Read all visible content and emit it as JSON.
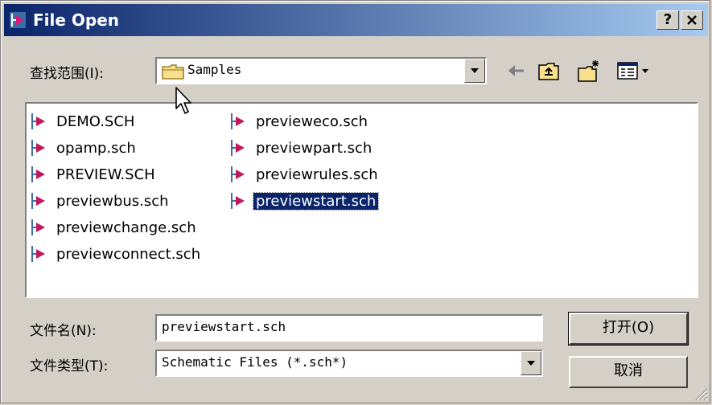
{
  "titlebar": {
    "title": "File Open",
    "help_label": "?",
    "close_label": "X"
  },
  "lookin": {
    "label": "查找范围(I):",
    "value": "Samples"
  },
  "files": {
    "col1": [
      "DEMO.SCH",
      "opamp.sch",
      "PREVIEW.SCH",
      "previewbus.sch",
      "previewchange.sch",
      "previewconnect.sch"
    ],
    "col2": [
      "previeweco.sch",
      "previewpart.sch",
      "previewrules.sch",
      "previewstart.sch"
    ],
    "selected": "previewstart.sch"
  },
  "filename": {
    "label": "文件名(N):",
    "value": "previewstart.sch"
  },
  "filetype": {
    "label": "文件类型(T):",
    "value": "Schematic Files (*.sch*)"
  },
  "buttons": {
    "open": "打开(O)",
    "cancel": "取消"
  },
  "colors": {
    "title_start": "#0a246a",
    "title_end": "#a6caf0",
    "selection": "#0a246a",
    "face": "#d4d0c8"
  },
  "icons": [
    "app-icon",
    "folder-icon",
    "back-arrow-icon",
    "up-folder-icon",
    "new-folder-icon",
    "view-menu-icon",
    "schematic-file-icon",
    "mouse-cursor-icon",
    "resize-grip-icon"
  ]
}
